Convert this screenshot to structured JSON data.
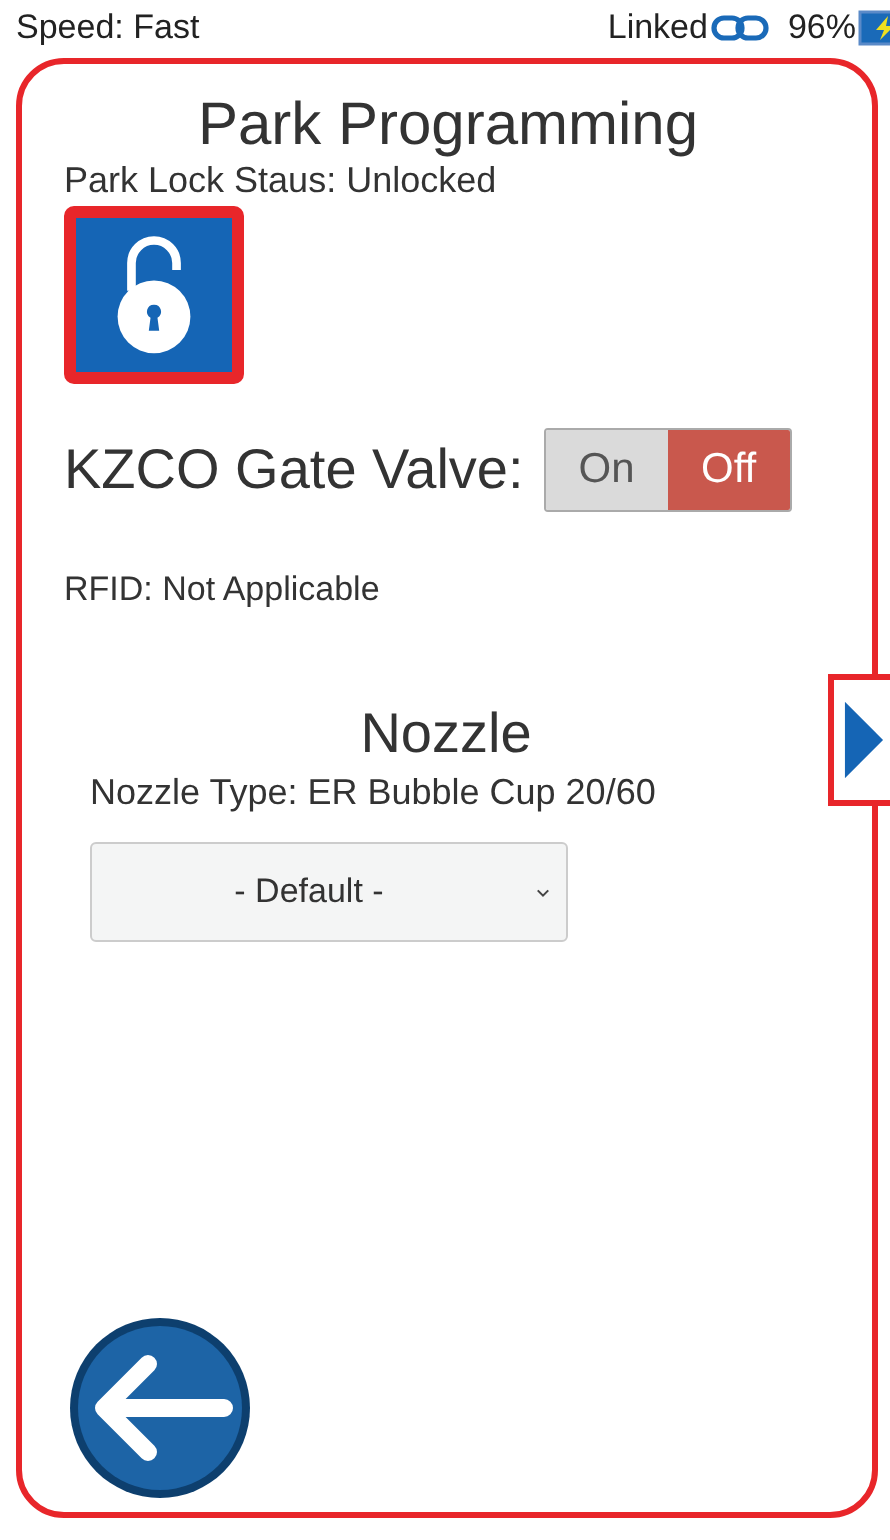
{
  "status_bar": {
    "speed": "Speed: Fast",
    "link": "Linked",
    "battery": "96%"
  },
  "title": "Park Programming",
  "lock_status": "Park Lock Staus: Unlocked",
  "lock": {
    "locked": false
  },
  "gate_valve": {
    "label": "KZCO Gate Valve:",
    "options": [
      {
        "label": "On",
        "selected": false
      },
      {
        "label": "Off",
        "selected": true
      }
    ]
  },
  "rfid": "RFID: Not Applicable",
  "nozzle": {
    "heading": "Nozzle",
    "type": "Nozzle Type: ER Bubble Cup 20/60",
    "select_value": "- Default -"
  }
}
